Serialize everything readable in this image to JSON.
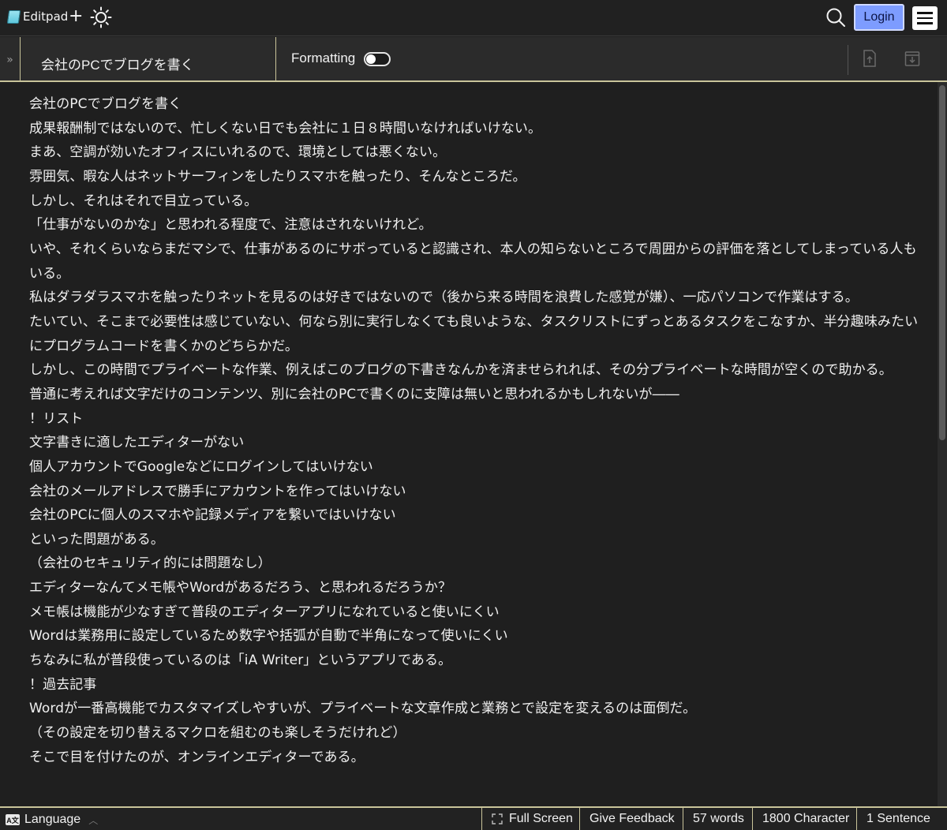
{
  "app": {
    "name": "Editpad",
    "login_label": "Login"
  },
  "toolbar": {
    "collapse_glyph": "»",
    "doc_title": "会社のPCでブログを書く",
    "formatting_label": "Formatting",
    "formatting_on": false
  },
  "editor": {
    "lines": [
      "会社のPCでブログを書く",
      "成果報酬制ではないので、忙しくない日でも会社に１日８時間いなければいけない。",
      "まあ、空調が効いたオフィスにいれるので、環境としては悪くない。",
      "雰囲気、暇な人はネットサーフィンをしたりスマホを触ったり、そんなところだ。",
      "しかし、それはそれで目立っている。",
      "「仕事がないのかな」と思われる程度で、注意はされないけれど。",
      "いや、それくらいならまだマシで、仕事があるのにサボっていると認識され、本人の知らないところで周囲からの評価を落としてしまっている人もいる。",
      "私はダラダラスマホを触ったりネットを見るのは好きではないので（後から来る時間を浪費した感覚が嫌）、一応パソコンで作業はする。",
      "たいてい、そこまで必要性は感じていない、何なら別に実行しなくても良いような、タスクリストにずっとあるタスクをこなすか、半分趣味みたいにプログラムコードを書くかのどちらかだ。",
      "しかし、この時間でプライベートな作業、例えばこのブログの下書きなんかを済ませられれば、その分プライベートな時間が空くので助かる。",
      "普通に考えれば文字だけのコンテンツ、別に会社のPCで書くのに支障は無いと思われるかもしれないが――",
      "！リスト",
      "文字書きに適したエディターがない",
      "個人アカウントでGoogleなどにログインしてはいけない",
      "会社のメールアドレスで勝手にアカウントを作ってはいけない",
      "会社のPCに個人のスマホや記録メディアを繋いではいけない",
      "といった問題がある。",
      "（会社のセキュリティ的には問題なし）",
      "エディターなんてメモ帳やWordがあるだろう、と思われるだろうか？",
      "メモ帳は機能が少なすぎて普段のエディターアプリになれていると使いにくい",
      "Wordは業務用に設定しているため数字や括弧が自動で半角になって使いにくい",
      "ちなみに私が普段使っているのは「iA Writer」というアプリである。",
      "！過去記事",
      "Wordが一番高機能でカスタマイズしやすいが、プライベートな文章作成と業務とで設定を変えるのは面倒だ。",
      "（その設定を切り替えるマクロを組むのも楽しそうだけれど）",
      "そこで目を付けたのが、オンラインエディターである。"
    ]
  },
  "statusbar": {
    "language_icon": "A文",
    "language_label": "Language",
    "fullscreen_label": "Full Screen",
    "feedback_label": "Give Feedback",
    "words": "57 words",
    "characters": "1800 Character",
    "sentences": "1 Sentence"
  }
}
